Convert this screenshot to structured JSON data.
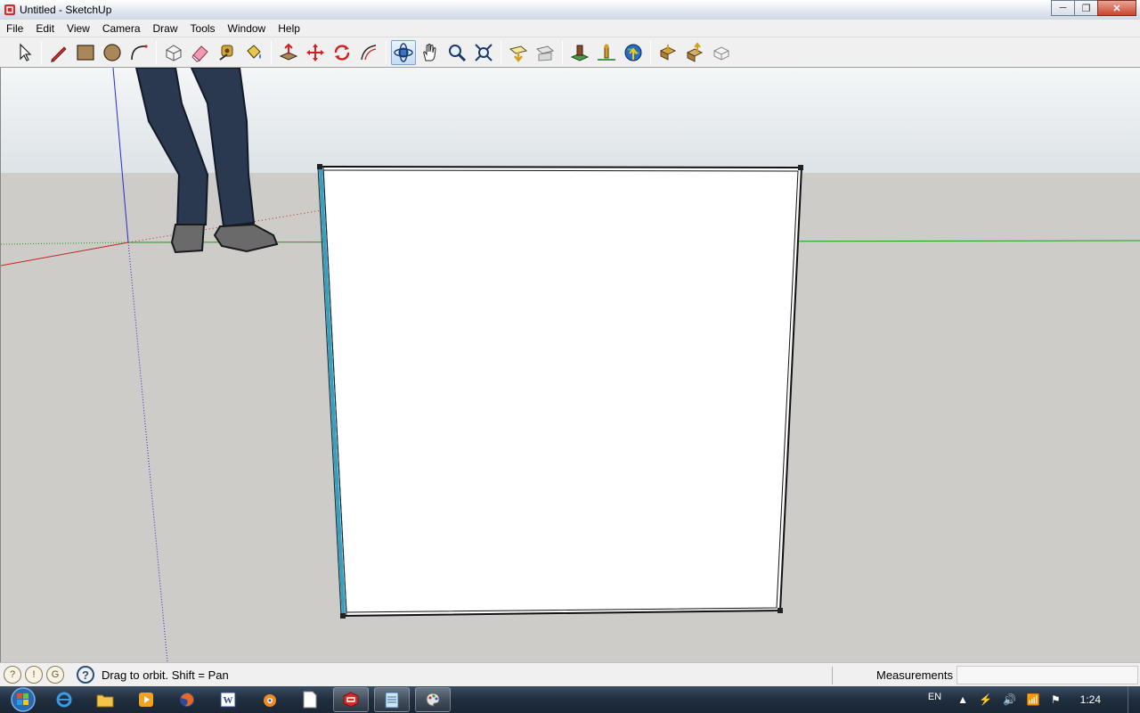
{
  "window": {
    "title": "Untitled - SketchUp",
    "minimize": "─",
    "maximize": "❐",
    "close": "✕"
  },
  "menu": [
    "File",
    "Edit",
    "View",
    "Camera",
    "Draw",
    "Tools",
    "Window",
    "Help"
  ],
  "toolbar": {
    "tools": [
      {
        "name": "select",
        "icon": "arrow-cursor-icon"
      },
      {
        "name": "line",
        "icon": "pencil-icon"
      },
      {
        "name": "rectangle",
        "icon": "rectangle-icon"
      },
      {
        "name": "circle",
        "icon": "circle-icon"
      },
      {
        "name": "arc",
        "icon": "arc-icon"
      },
      {
        "name": "make-component",
        "icon": "component-icon"
      },
      {
        "name": "eraser",
        "icon": "eraser-icon"
      },
      {
        "name": "tape-measure",
        "icon": "tape-measure-icon"
      },
      {
        "name": "paint-bucket",
        "icon": "paint-bucket-icon"
      },
      {
        "name": "push-pull",
        "icon": "push-pull-icon"
      },
      {
        "name": "move",
        "icon": "move-icon"
      },
      {
        "name": "rotate",
        "icon": "rotate-icon"
      },
      {
        "name": "offset",
        "icon": "offset-icon"
      },
      {
        "name": "orbit",
        "icon": "orbit-icon",
        "active": true
      },
      {
        "name": "pan",
        "icon": "hand-icon"
      },
      {
        "name": "zoom",
        "icon": "magnifier-icon"
      },
      {
        "name": "zoom-extents",
        "icon": "zoom-extents-icon"
      },
      {
        "name": "previous-view",
        "icon": "previous-icon"
      },
      {
        "name": "next-view",
        "icon": "next-icon"
      },
      {
        "name": "add-location",
        "icon": "location-icon"
      },
      {
        "name": "toggle-terrain",
        "icon": "terrain-icon"
      },
      {
        "name": "preview-google-earth",
        "icon": "earth-icon"
      },
      {
        "name": "get-models",
        "icon": "get-models-icon"
      },
      {
        "name": "share-model",
        "icon": "share-model-icon"
      },
      {
        "name": "share-component",
        "icon": "share-component-icon"
      }
    ]
  },
  "status": {
    "hint": "Drag to orbit.  Shift = Pan",
    "measurements_label": "Measurements",
    "measurements_value": "",
    "geo_icons": [
      "geolocation-icon",
      "credits-icon",
      "user-icon"
    ],
    "help_glyph": "?"
  },
  "taskbar": {
    "apps": [
      "internet-explorer-icon",
      "folder-icon",
      "media-player-icon",
      "firefox-icon",
      "word-icon",
      "blender-icon",
      "document-icon",
      "sketchup-icon",
      "notepad-icon",
      "paint-icon"
    ],
    "language": "EN",
    "clock": "1:24"
  },
  "colors": {
    "sky": "#e8ecee",
    "ground": "#cdccc8",
    "axis_red": "#cc2020",
    "axis_green": "#1a9e1a",
    "axis_blue": "#2a2ac8",
    "edge_selected": "#38a0c0"
  }
}
